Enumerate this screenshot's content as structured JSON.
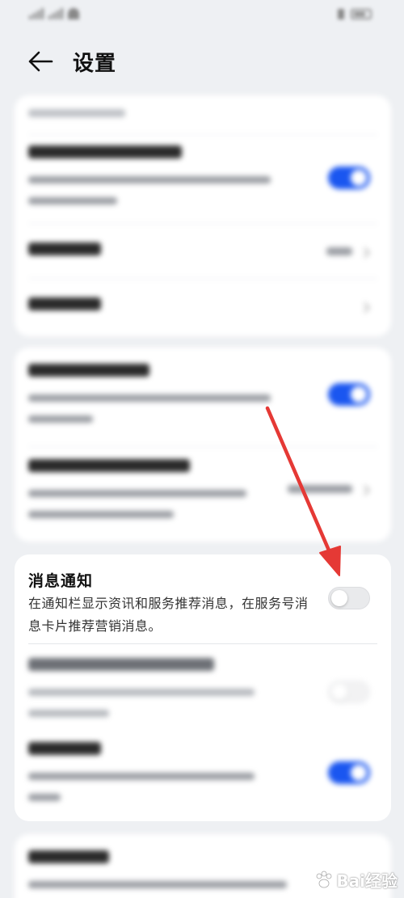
{
  "header": {
    "title": "设置"
  },
  "message_setting": {
    "title": "消息通知",
    "description": "在通知栏显示资讯和服务推荐消息，在服务号消息卡片推荐营销消息。",
    "enabled": false
  },
  "watermark": {
    "text": "Bai经验"
  },
  "colors": {
    "toggle_on": "#1a56f0",
    "arrow": "#e53935",
    "background": "#eef0f3"
  }
}
